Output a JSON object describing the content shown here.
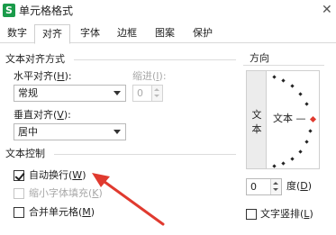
{
  "window": {
    "app_icon": "S",
    "title": "单元格格式",
    "close": "✕"
  },
  "tabs": [
    {
      "label": "数字",
      "active": false
    },
    {
      "label": "对齐",
      "active": true
    },
    {
      "label": "字体",
      "active": false
    },
    {
      "label": "边框",
      "active": false
    },
    {
      "label": "图案",
      "active": false
    },
    {
      "label": "保护",
      "active": false
    }
  ],
  "text_alignment": {
    "heading": "文本对齐方式",
    "horizontal": {
      "label_pre": "水平对齐(",
      "key": "H",
      "label_post": "):",
      "value": "常规"
    },
    "indent": {
      "label_pre": "缩进(",
      "key": "I",
      "label_post": "):",
      "value": "0"
    },
    "vertical": {
      "label_pre": "垂直对齐(",
      "key": "V",
      "label_post": "):",
      "value": "居中"
    }
  },
  "text_control": {
    "heading": "文本控制",
    "wrap": {
      "label_pre": "自动换行(",
      "key": "W",
      "label_post": ")",
      "checked": true
    },
    "shrink": {
      "label_pre": "缩小字体填充(",
      "key": "K",
      "label_post": ")",
      "checked": false
    },
    "merge": {
      "label_pre": "合并单元格(",
      "key": "M",
      "label_post": ")",
      "checked": false
    }
  },
  "orientation": {
    "heading": "方向",
    "vertical_chars": [
      "文",
      "本"
    ],
    "horizontal_text": "文本 —",
    "degrees_value": "0",
    "degrees_pre": "度(",
    "degrees_key": "D",
    "degrees_post": ")",
    "vertical_text": {
      "label_pre": "文字竖排(",
      "key": "L",
      "label_post": ")",
      "checked": false
    }
  },
  "colors": {
    "accent_red": "#e03a2f",
    "checkbox_check": "#222222",
    "app_icon_green": "#1a9b4a"
  }
}
